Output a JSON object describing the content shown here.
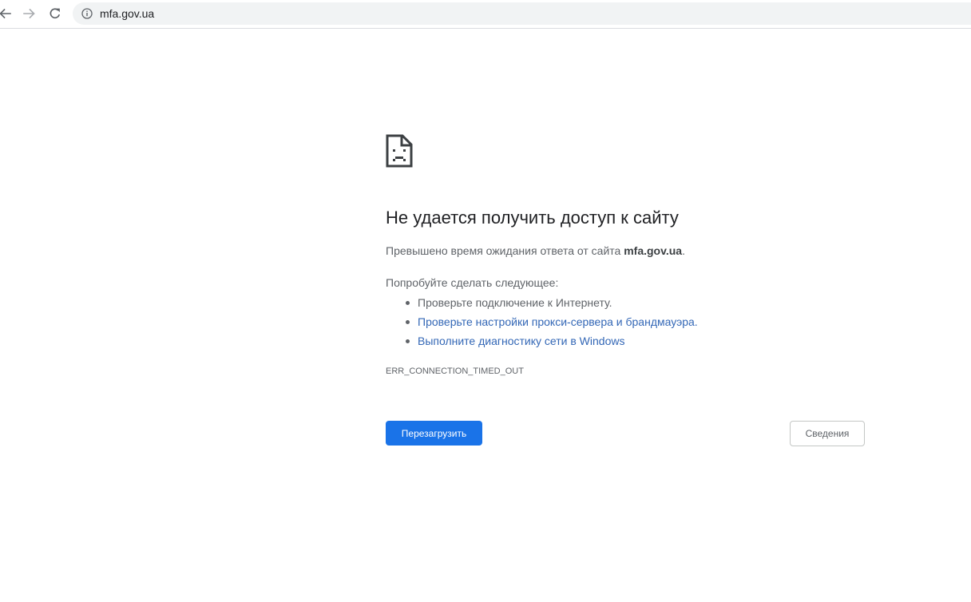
{
  "browser": {
    "url": "mfa.gov.ua",
    "icons": {
      "back": "arrow-left-icon",
      "forward": "arrow-right-icon",
      "reload": "reload-icon",
      "site_info": "info-icon"
    }
  },
  "error_page": {
    "icon": "sad-page-icon",
    "title": "Не удается получить доступ к сайту",
    "summary_prefix": "Превышено время ожидания ответа от сайта ",
    "summary_host": "mfa.gov.ua",
    "summary_suffix": ".",
    "suggestions_heading": "Попробуйте сделать следующее:",
    "suggestions": [
      "Проверьте подключение к Интернету.",
      "Проверьте настройки прокси-сервера и брандмауэра.",
      "Выполните диагностику сети в Windows"
    ],
    "error_code": "ERR_CONNECTION_TIMED_OUT",
    "reload_label": "Перезагрузить",
    "details_label": "Сведения"
  },
  "colors": {
    "primary_button": "#1a73e8",
    "link": "#3367b6",
    "text_secondary": "#5f6368",
    "omnibox_bg": "#f1f3f4"
  }
}
